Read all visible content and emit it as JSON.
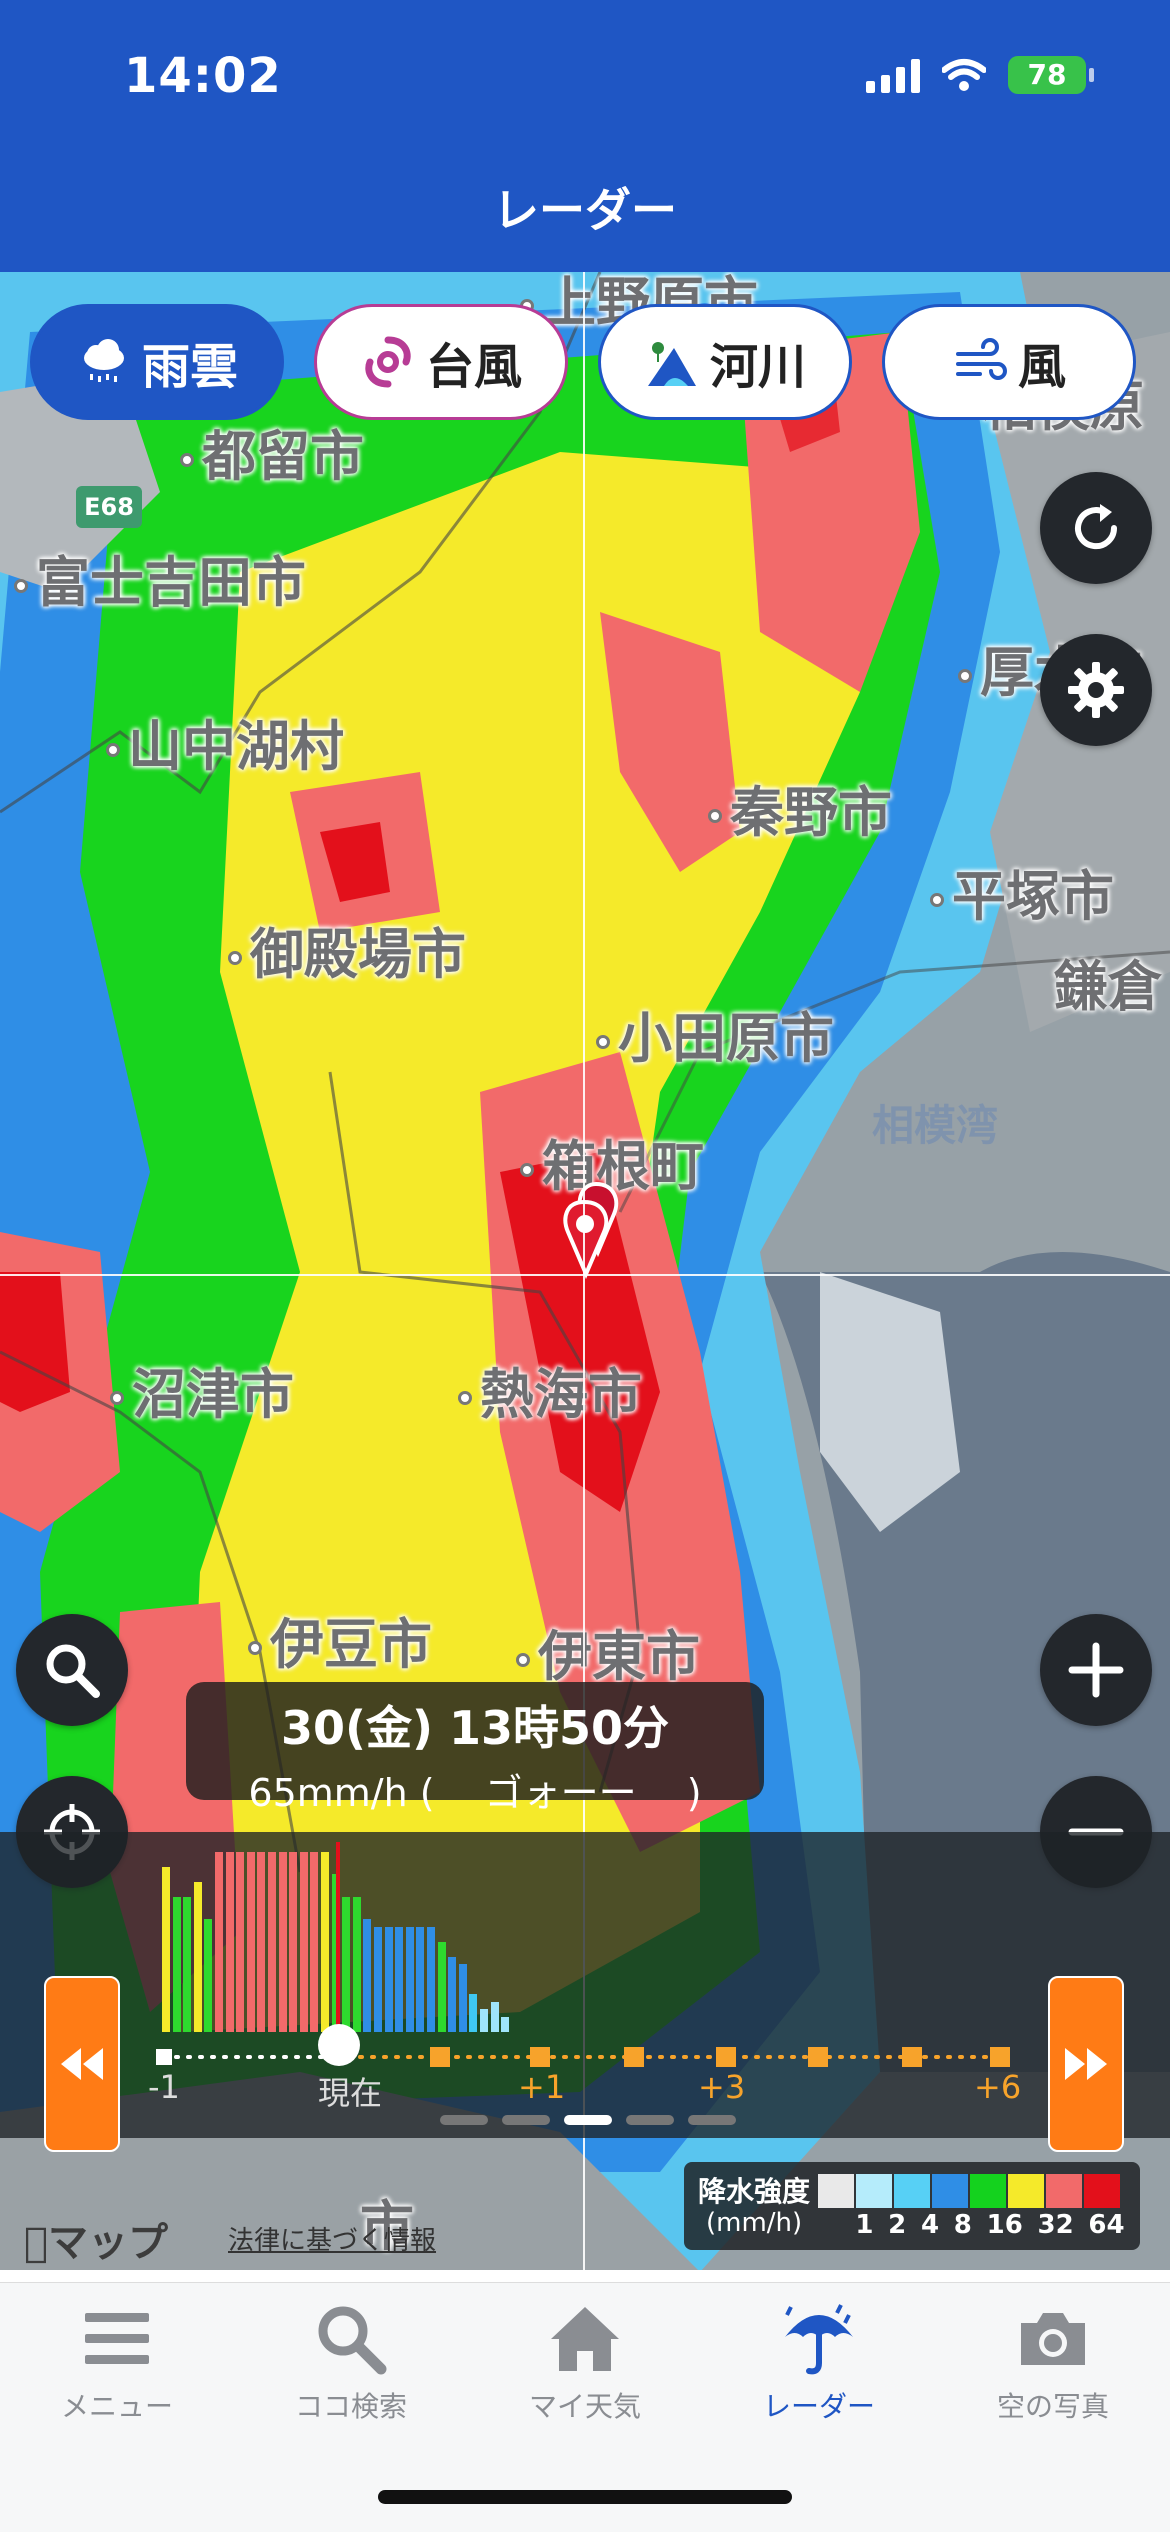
{
  "status_bar": {
    "time": "14:02",
    "battery": "78"
  },
  "header": {
    "title": "レーダー"
  },
  "layer_chips": [
    {
      "label": "雨雲",
      "icon": "rain-cloud-icon",
      "active": true
    },
    {
      "label": "台風",
      "icon": "typhoon-icon",
      "active": false
    },
    {
      "label": "河川",
      "icon": "river-icon",
      "active": false
    },
    {
      "label": "風",
      "icon": "wind-icon",
      "active": false
    }
  ],
  "map": {
    "road_badge": "E68",
    "cities": {
      "uenohara": "上野原市",
      "tsuru": "都留市",
      "fujiyoshida": "富士吉田市",
      "yamanakako": "山中湖村",
      "hadano": "秦野市",
      "atsugi": "厚木市",
      "hiratsuka": "平塚市",
      "kamakura": "鎌倉",
      "sagamihara_partial": "相模原",
      "gotemba": "御殿場市",
      "odawara": "小田原市",
      "hakone": "箱根町",
      "atami": "熱海市",
      "numazu": "沼津市",
      "izu": "伊豆市",
      "ito": "伊東市",
      "bottom_partial": "市"
    },
    "bay": "相模湾",
    "attribution": "マップ",
    "legal": "法律に基づく情報"
  },
  "time_label": {
    "main": "30(金) 13時50分",
    "sub": "65mm/h (　 ゴォーー　 )"
  },
  "timeline": {
    "labels": [
      "-1",
      "現在",
      "+1",
      "+3",
      "+6"
    ],
    "bars": [
      44,
      36,
      36,
      40,
      30,
      48,
      48,
      48,
      48,
      48,
      48,
      48,
      48,
      48,
      48,
      48,
      42,
      36,
      36,
      30,
      28,
      28,
      28,
      28,
      28,
      28,
      24,
      20,
      18,
      10,
      6,
      8,
      4
    ],
    "bar_colors": [
      "#f5ea2a",
      "#2ed92e",
      "#2ed92e",
      "#f5ea2a",
      "#2ed92e",
      "#f26a6a",
      "#f26a6a",
      "#f26a6a",
      "#f26a6a",
      "#f26a6a",
      "#f26a6a",
      "#f26a6a",
      "#f26a6a",
      "#f26a6a",
      "#f26a6a",
      "#f5ea2a",
      "#2ed92e",
      "#2ed92e",
      "#2ed92e",
      "#2f8ee6",
      "#2f8ee6",
      "#2f8ee6",
      "#2f8ee6",
      "#2f8ee6",
      "#2f8ee6",
      "#2f8ee6",
      "#2ed92e",
      "#2f8ee6",
      "#2f8ee6",
      "#3fc8f2",
      "#9fe4fb",
      "#9fe4fb",
      "#9fe4fb"
    ],
    "page_active": 2
  },
  "legend": {
    "title": "降水強度",
    "unit": "(mm/h)",
    "values": [
      "1",
      "2",
      "4",
      "8",
      "16",
      "32",
      "64"
    ],
    "colors": [
      "#e9e9e9",
      "#b5ecfb",
      "#57d0f5",
      "#2f8ee6",
      "#14d21e",
      "#f5ea2a",
      "#f26a6a",
      "#e3101b"
    ]
  },
  "tabs": [
    {
      "label": "メニュー",
      "icon": "menu-icon",
      "active": false
    },
    {
      "label": "ココ検索",
      "icon": "search-icon",
      "active": false
    },
    {
      "label": "マイ天気",
      "icon": "home-icon",
      "active": false
    },
    {
      "label": "レーダー",
      "icon": "umbrella-icon",
      "active": true
    },
    {
      "label": "空の写真",
      "icon": "camera-icon",
      "active": false
    }
  ]
}
